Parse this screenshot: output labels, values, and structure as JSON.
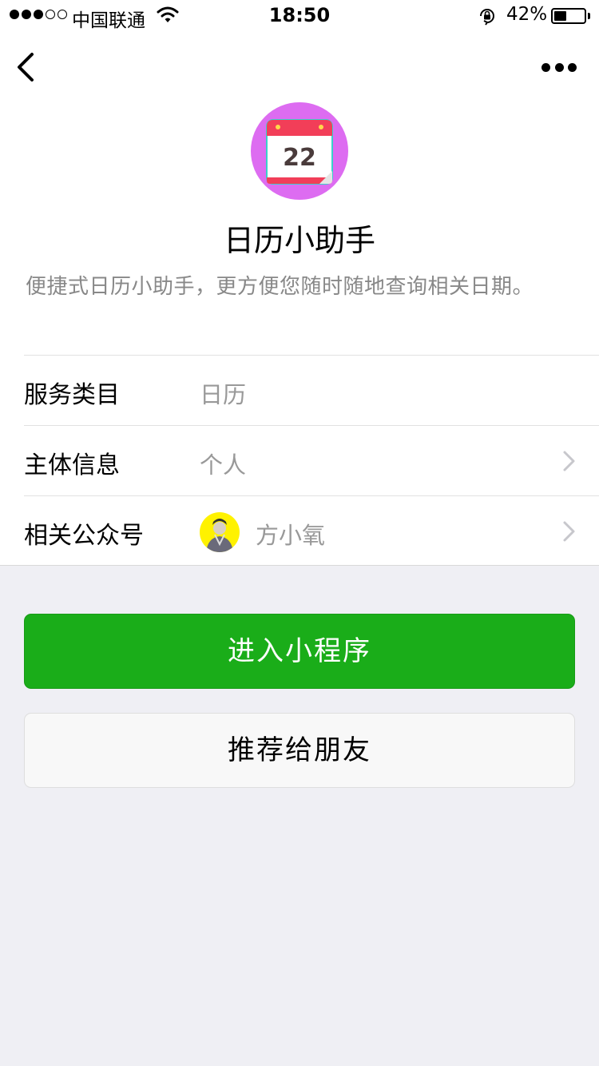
{
  "status_bar": {
    "carrier": "中国联通",
    "time": "18:50",
    "battery_percent": "42%",
    "battery_level": 0.42,
    "signal_bars_filled": 3,
    "signal_bars_total": 5
  },
  "nav": {
    "back_icon": "chevron-left-icon",
    "more_icon": "ellipsis-icon"
  },
  "app": {
    "icon": "calendar-icon",
    "icon_day": "22",
    "name": "日历小助手",
    "description": "便捷式日历小助手，更方便您随时随地查询相关日期。"
  },
  "info_rows": [
    {
      "label": "服务类目",
      "value": "日历"
    },
    {
      "label": "主体信息",
      "value": "个人"
    },
    {
      "label": "相关公众号",
      "value": "方小氧"
    }
  ],
  "buttons": {
    "primary": "进入小程序",
    "secondary": "推荐给朋友"
  },
  "colors": {
    "primary_green": "#1aad19",
    "icon_bg": "#dd6cf1",
    "calendar_red": "#f23e58",
    "avatar_bg": "#fff200"
  }
}
